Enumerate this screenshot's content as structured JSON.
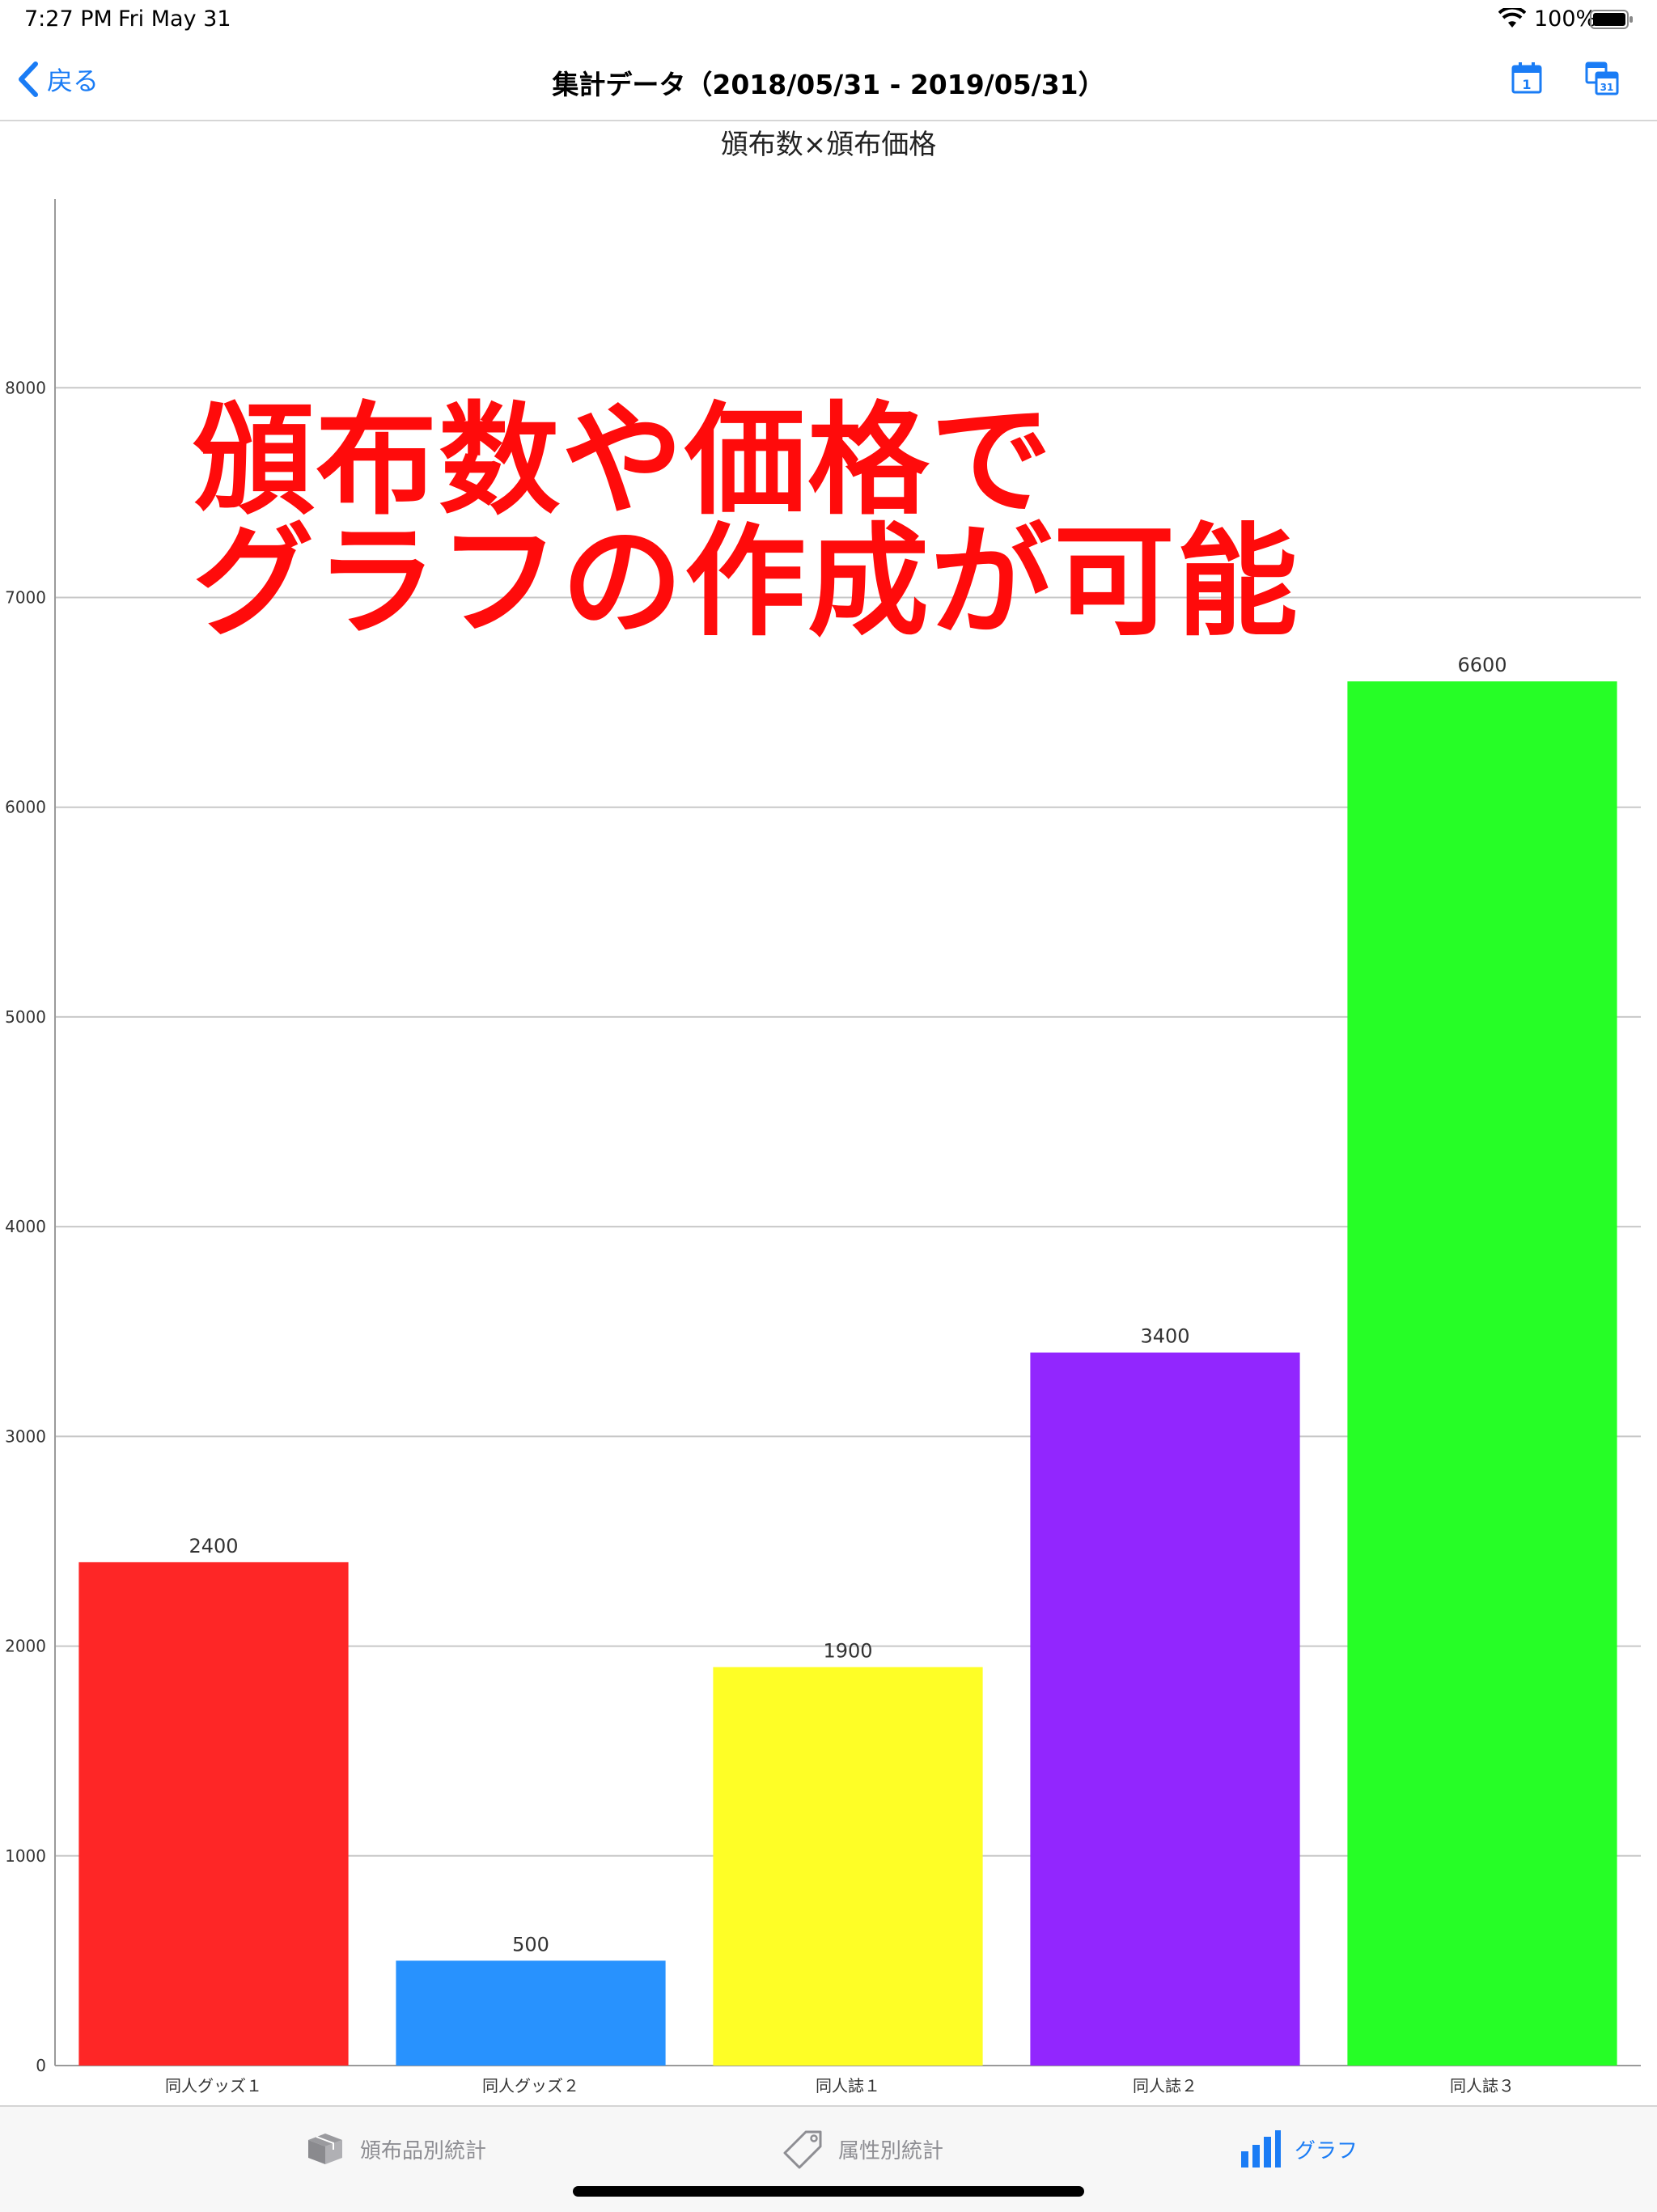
{
  "status_bar": {
    "time": "7:27 PM",
    "date": "Fri May 31",
    "battery": "100%"
  },
  "nav": {
    "back_label": "戻る",
    "title": "集計データ（2018/05/31 - 2019/05/31）"
  },
  "overlay": {
    "line1": "頒布数や価格で",
    "line2": "グラフの作成が可能"
  },
  "tabs": [
    {
      "label": "頒布品別統計",
      "icon": "box-icon",
      "active": false
    },
    {
      "label": "属性別統計",
      "icon": "tag-icon",
      "active": false
    },
    {
      "label": "グラフ",
      "icon": "bar-chart-icon",
      "active": true
    }
  ],
  "colors": {
    "accent": "#1a7cf5",
    "overlay_text": "#ff0b0b",
    "grid": "#c8c8c8"
  },
  "chart_data": {
    "type": "bar",
    "title": "頒布数×頒布価格",
    "categories": [
      "同人グッズ１",
      "同人グッズ２",
      "同人誌１",
      "同人誌２",
      "同人誌３"
    ],
    "values": [
      2400,
      500,
      1900,
      3400,
      6600
    ],
    "value_labels": [
      "2400",
      "500",
      "1900",
      "3400",
      "6600"
    ],
    "bar_colors": [
      "#fe2626",
      "#2892fe",
      "#fefe26",
      "#9226fe",
      "#26fe26"
    ],
    "yticks": [
      0,
      1000,
      2000,
      3000,
      4000,
      5000,
      6000,
      7000,
      8000
    ],
    "ylim": [
      0,
      8900
    ],
    "grid": true,
    "legend": "none"
  }
}
